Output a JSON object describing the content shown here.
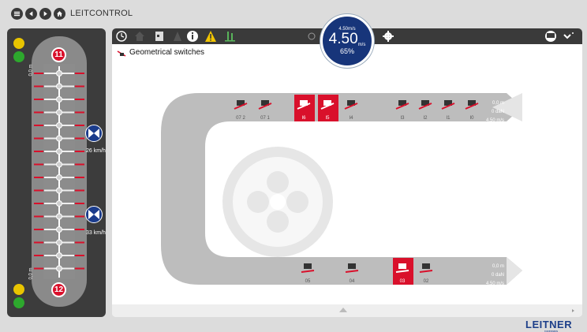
{
  "app": {
    "title": "LEITCONTROL"
  },
  "main": {
    "section_title": "Geometrical switches",
    "speed": {
      "top": "4.50m/s",
      "value": "4.50",
      "unit": "m/s",
      "percent": "65%"
    },
    "upper_track": {
      "switches": [
        "07 2",
        "07 1",
        "I6",
        "I5",
        "I4",
        "I3",
        "I2",
        "I1",
        "I0"
      ],
      "readout": [
        "0,0 m",
        "0 daN",
        "4,50 m/s"
      ]
    },
    "lower_track": {
      "switches": [
        "05",
        "04",
        "03",
        "02"
      ],
      "readout": [
        "0,0 m",
        "0 daN",
        "4,50 m/s"
      ]
    }
  },
  "left_panel": {
    "station_top": "11",
    "station_bottom": "12",
    "cabin_speeds": [
      "26 km/h",
      "33 km/h"
    ],
    "scale_top": "0,0 m",
    "scale_bottom": "0,0 m"
  },
  "branding": {
    "logo": "LEITNER",
    "subtitle": "ropeways"
  },
  "colors": {
    "accent_red": "#d9102b",
    "dark": "#3a3a3a",
    "badge_blue": "#17357a",
    "track_gray": "#8a8a8a",
    "brand_blue": "#1d3f8a"
  }
}
